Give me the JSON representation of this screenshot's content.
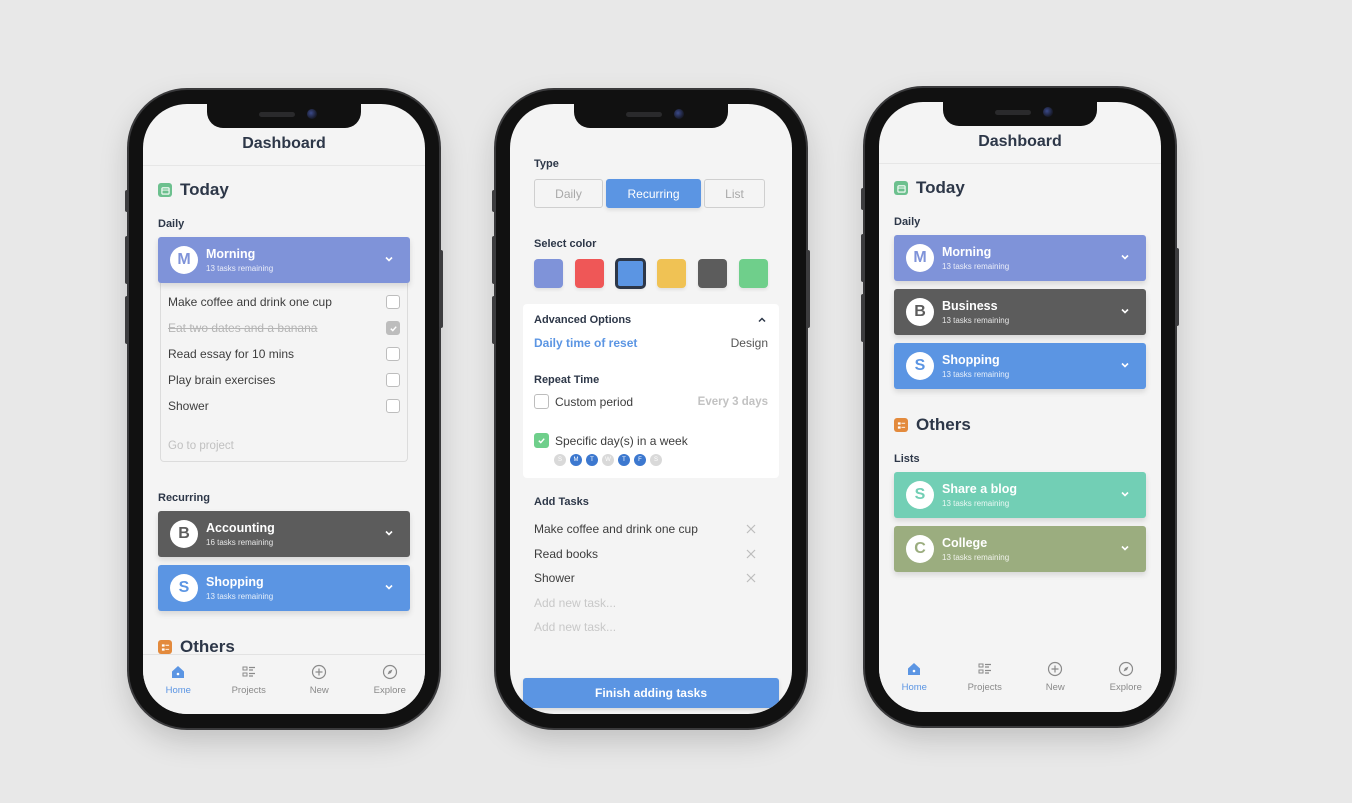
{
  "colors": {
    "accent": "#5b95e3",
    "morning": "#7f93d9",
    "dark": "#5c5c5c",
    "blue": "#5b95e3",
    "teal": "#72cfb5",
    "olive": "#9bad7f",
    "green_icon": "#6cc08e",
    "orange_icon": "#e38a3c"
  },
  "phone1": {
    "header_title": "Dashboard",
    "today_title": "Today",
    "daily_label": "Daily",
    "morning": {
      "initial": "M",
      "title": "Morning",
      "subtitle": "13 tasks remaining"
    },
    "tasks": [
      {
        "text": "Make coffee and drink one cup",
        "done": false
      },
      {
        "text": "Eat two dates and a banana",
        "done": true
      },
      {
        "text": "Read essay for 10 mins",
        "done": false
      },
      {
        "text": "Play brain exercises",
        "done": false
      },
      {
        "text": "Shower",
        "done": false
      }
    ],
    "go_to_project": "Go to project",
    "recurring_label": "Recurring",
    "recurring": [
      {
        "initial": "B",
        "title": "Accounting",
        "subtitle": "16 tasks remaining"
      },
      {
        "initial": "S",
        "title": "Shopping",
        "subtitle": "13 tasks remaining"
      }
    ],
    "others_title": "Others"
  },
  "phone2": {
    "type_label": "Type",
    "type_options": [
      "Daily",
      "Recurring",
      "List"
    ],
    "type_selected": "Recurring",
    "select_color_label": "Select color",
    "swatches": [
      "#7f93d9",
      "#ef5757",
      "#5b95e3",
      "#f0c254",
      "#5c5c5c",
      "#6fcf8b"
    ],
    "swatch_selected": "#5b95e3",
    "advanced_title": "Advanced Options",
    "daily_reset_link": "Daily time of reset",
    "daily_reset_value": "Design",
    "repeat_time_label": "Repeat Time",
    "custom_period_label": "Custom period",
    "custom_period_checked": false,
    "custom_period_value": "Every 3 days",
    "specific_days_label": "Specific day(s) in a week",
    "specific_days_checked": true,
    "days": [
      {
        "letter": "S",
        "on": false
      },
      {
        "letter": "M",
        "on": true
      },
      {
        "letter": "T",
        "on": true
      },
      {
        "letter": "W",
        "on": false
      },
      {
        "letter": "T",
        "on": true
      },
      {
        "letter": "F",
        "on": true
      },
      {
        "letter": "S",
        "on": false
      }
    ],
    "add_tasks_label": "Add Tasks",
    "added_tasks": [
      "Make coffee and drink one cup",
      "Read books",
      "Shower"
    ],
    "new_task_placeholder": "Add new task...",
    "finish_button": "Finish adding tasks"
  },
  "phone3": {
    "header_title": "Dashboard",
    "today_title": "Today",
    "daily_label": "Daily",
    "daily": [
      {
        "initial": "M",
        "title": "Morning",
        "subtitle": "13 tasks remaining"
      },
      {
        "initial": "B",
        "title": "Business",
        "subtitle": "13 tasks remaining"
      },
      {
        "initial": "S",
        "title": "Shopping",
        "subtitle": "13 tasks remaining"
      }
    ],
    "others_title": "Others",
    "lists_label": "Lists",
    "lists": [
      {
        "initial": "S",
        "title": "Share a blog",
        "subtitle": "13 tasks remaining"
      },
      {
        "initial": "C",
        "title": "College",
        "subtitle": "13 tasks remaining"
      }
    ]
  },
  "tabbar": {
    "items": [
      {
        "label": "Home",
        "icon": "home-icon",
        "active": true
      },
      {
        "label": "Projects",
        "icon": "list-icon",
        "active": false
      },
      {
        "label": "New",
        "icon": "plus-circle-icon",
        "active": false
      },
      {
        "label": "Explore",
        "icon": "compass-icon",
        "active": false
      }
    ]
  }
}
